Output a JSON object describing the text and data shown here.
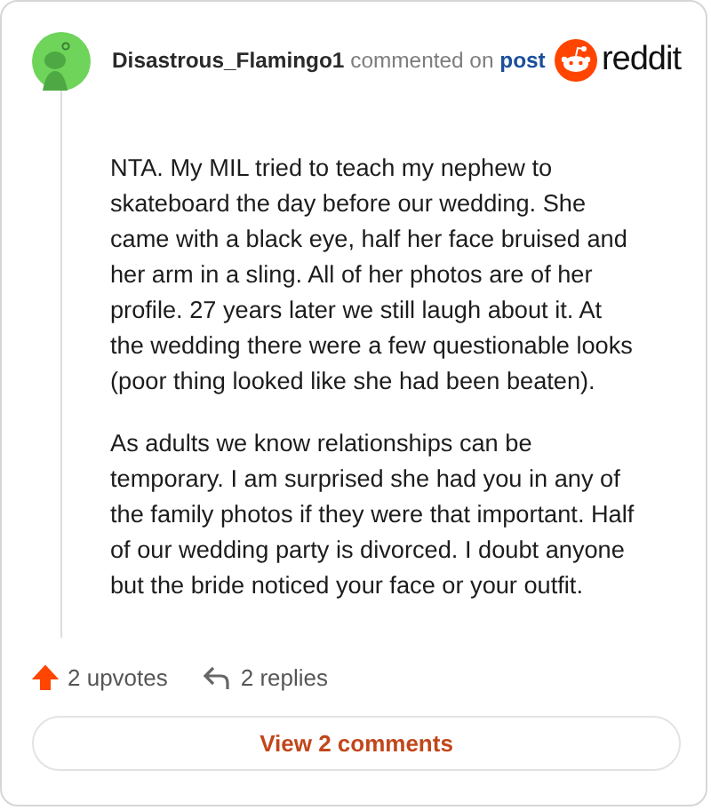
{
  "comment": {
    "author": "Disastrous_Flamingo1",
    "action": "commented on",
    "link": "post",
    "brand": "reddit",
    "paragraphs": [
      "NTA. My MIL tried to teach my nephew to skateboard the day before our wedding. She came with a black eye, half her face bruised and her arm in a sling. All of her photos are of her profile. 27 years later we still laugh about it. At the wedding there were a few questionable looks (poor thing looked like she had been beaten).",
      "As adults we know relationships can be temporary. I am surprised she had you in any of the family photos if they were that important. Half of our wedding party is divorced. I doubt anyone but the bride noticed your face or your outfit."
    ],
    "upvotes": "2 upvotes",
    "replies": "2 replies",
    "upvoted": true
  },
  "button": "View 2 comments"
}
